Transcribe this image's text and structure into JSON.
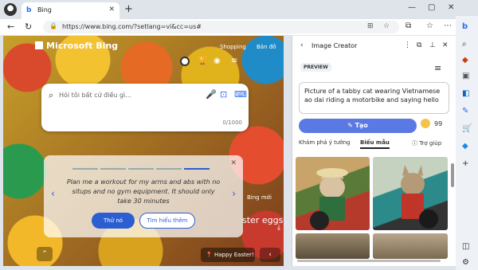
{
  "tab": {
    "title": "Bing"
  },
  "address": {
    "url": "https://www.bing.com/?setlang=vi&cc=us#"
  },
  "page": {
    "brand": "Microsoft Bing",
    "top_links": [
      "Shopping",
      "Bản đồ"
    ],
    "search_placeholder": "Hỏi tôi bất cứ điều gì...",
    "char_counter": "0/1000",
    "prompt_text": "Plan me a workout for my arms and abs with no situps and no gym equipment. It should only take 30 minutes",
    "try_button": "Thử nó",
    "learn_more_button": "Tìm hiểu thêm",
    "promo_small": "Bing mới",
    "promo_large": "ster eggs",
    "easter_label": "Happy Easter!"
  },
  "pane": {
    "title": "Image Creator",
    "badge": "PREVIEW",
    "prompt": "Picture of a tabby cat wearing Vietnamese ao dai riding a motorbike and saying hello",
    "create_label": "Tạo",
    "boost_count": "99",
    "tabs": [
      "Khám phá ý tưởng",
      "Biểu mẫu",
      "Trợ giúp"
    ]
  },
  "icons": {
    "sidebar": [
      "bing-icon",
      "search-icon",
      "tag-icon",
      "briefcase-icon",
      "outlook-icon",
      "compose-icon",
      "shopping-icon",
      "drop-icon",
      "add-icon",
      "layout-icon",
      "settings-icon"
    ]
  }
}
